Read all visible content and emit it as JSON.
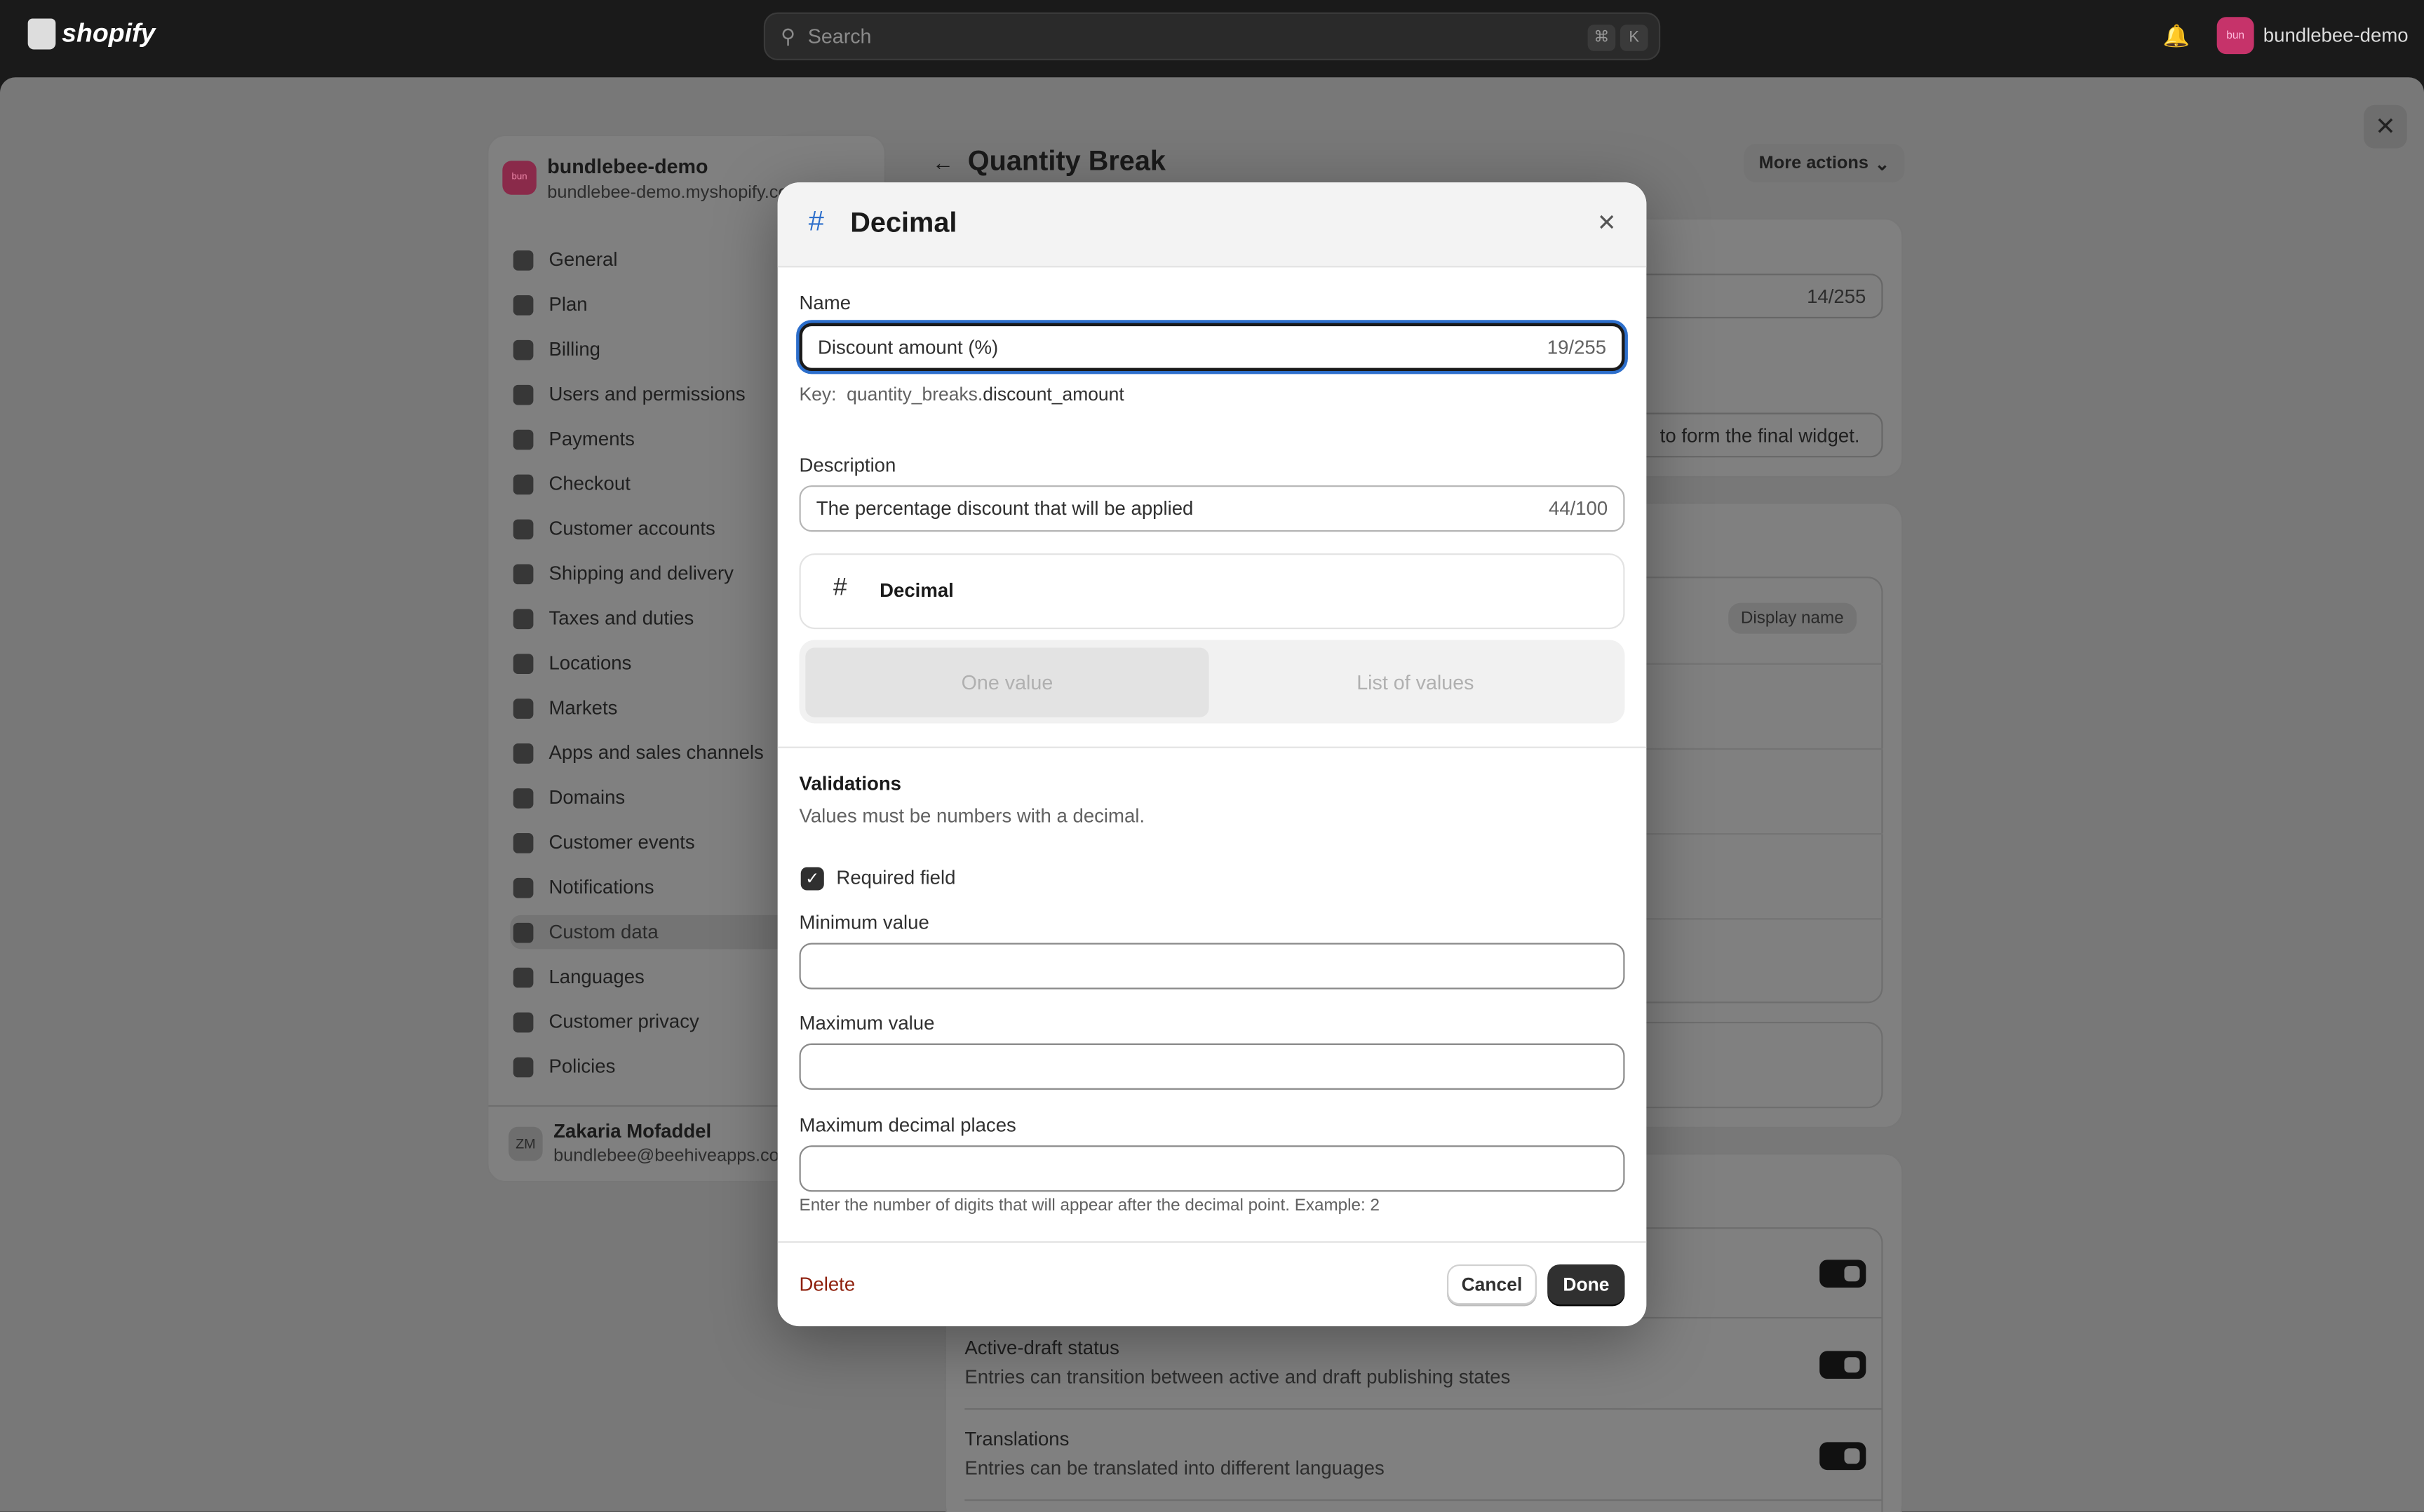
{
  "topbar": {
    "brand": "shopify",
    "search_placeholder": "Search",
    "kbd": [
      "⌘",
      "K"
    ],
    "store_name": "bundlebee-demo",
    "avatar_text": "bun"
  },
  "sidebar": {
    "store_name": "bundlebee-demo",
    "store_url": "bundlebee-demo.myshopify.com",
    "avatar_text": "bun",
    "items": [
      {
        "label": "General"
      },
      {
        "label": "Plan"
      },
      {
        "label": "Billing"
      },
      {
        "label": "Users and permissions"
      },
      {
        "label": "Payments"
      },
      {
        "label": "Checkout"
      },
      {
        "label": "Customer accounts"
      },
      {
        "label": "Shipping and delivery"
      },
      {
        "label": "Taxes and duties"
      },
      {
        "label": "Locations"
      },
      {
        "label": "Markets"
      },
      {
        "label": "Apps and sales channels"
      },
      {
        "label": "Domains"
      },
      {
        "label": "Customer events"
      },
      {
        "label": "Notifications"
      },
      {
        "label": "Custom data",
        "active": true
      },
      {
        "label": "Languages"
      },
      {
        "label": "Customer privacy"
      },
      {
        "label": "Policies"
      }
    ],
    "user": {
      "initials": "ZM",
      "name": "Zakaria Mofaddel",
      "email": "bundlebee@beehiveapps.com"
    }
  },
  "main": {
    "title": "Quantity Break",
    "more_actions": "More actions",
    "name_count": "14/255",
    "description_fragment": "to form the final widget.",
    "badge": "Display name",
    "options": [
      {
        "title": "Active-draft status",
        "desc": "Entries can transition between active and draft publishing states",
        "on": true
      },
      {
        "title": "Translations",
        "desc": "Entries can be translated into different languages",
        "on": true
      }
    ]
  },
  "modal": {
    "title": "Decimal",
    "accent": "#2c6ecb",
    "name_label": "Name",
    "name_value": "Discount amount (%)",
    "name_count": "19/255",
    "key_label": "Key:",
    "key_prefix": "quantity_breaks.",
    "key_suffix": "discount_amount",
    "description_label": "Description",
    "description_value": "The percentage discount that will be applied",
    "description_count": "44/100",
    "type_label": "Decimal",
    "tabs": [
      "One value",
      "List of values"
    ],
    "selected_tab": "One value",
    "validations_title": "Validations",
    "validations_sub": "Values must be numbers with a decimal.",
    "required_label": "Required field",
    "required_checked": true,
    "min_label": "Minimum value",
    "min_value": "",
    "max_label": "Maximum value",
    "max_value": "",
    "decimals_label": "Maximum decimal places",
    "decimals_value": "",
    "decimals_help": "Enter the number of digits that will appear after the decimal point. Example: 2",
    "delete": "Delete",
    "cancel": "Cancel",
    "done": "Done"
  }
}
